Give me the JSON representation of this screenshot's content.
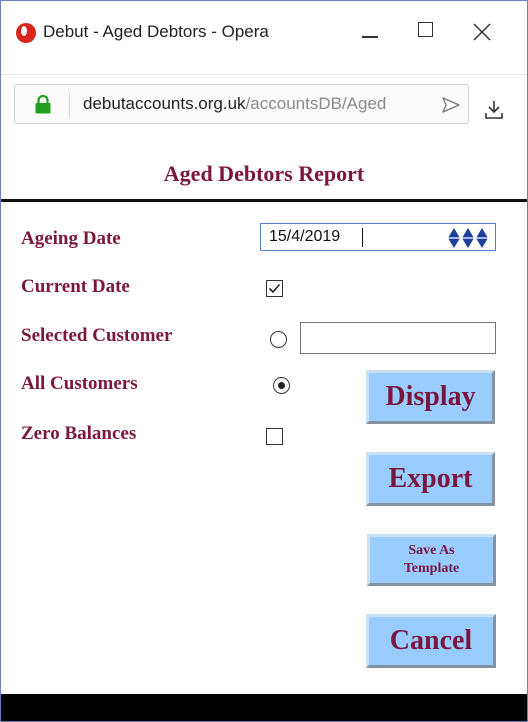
{
  "window": {
    "title": "Debut - Aged Debtors - Opera",
    "browser_icon": "opera-icon",
    "controls": [
      "minimize-icon",
      "maximize-icon",
      "close-icon"
    ]
  },
  "addressbar": {
    "url_host": "debutaccounts.org.uk",
    "url_path": "/accountsDB/Aged",
    "secure_icon": "lock-icon",
    "secure_color": "#1fa01f"
  },
  "report": {
    "title": "Aged Debtors Report",
    "accent_color": "#7b1640",
    "button_color": "#99ccff"
  },
  "form": {
    "ageing_date": {
      "label": "Ageing Date",
      "value": "15/4/2019"
    },
    "current_date": {
      "label": "Current Date",
      "checked": true
    },
    "selected_customer": {
      "label": "Selected Customer",
      "selected": false,
      "value": ""
    },
    "all_customers": {
      "label": "All Customers",
      "selected": true
    },
    "zero_balances": {
      "label": "Zero Balances",
      "checked": false
    }
  },
  "buttons": {
    "display": "Display",
    "export": "Export",
    "save_template_line1": "Save As",
    "save_template_line2": "Template",
    "cancel": "Cancel"
  }
}
